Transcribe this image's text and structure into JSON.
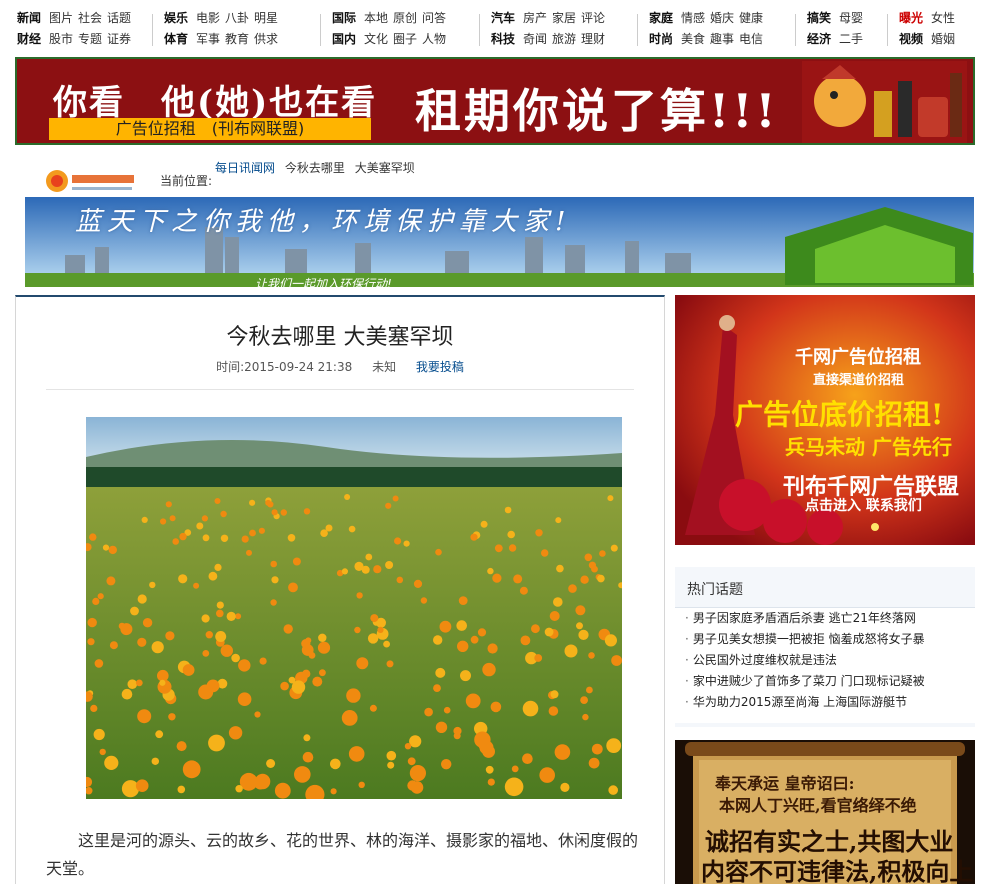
{
  "nav": {
    "groups": [
      {
        "row1": [
          "新闻",
          "图片",
          "社会",
          "话题"
        ],
        "row2": [
          "财经",
          "股市",
          "专题",
          "证券"
        ]
      },
      {
        "row1": [
          "娱乐",
          "电影",
          "八卦",
          "明星"
        ],
        "row2": [
          "体育",
          "军事",
          "教育",
          "供求"
        ]
      },
      {
        "row1": [
          "国际",
          "本地",
          "原创",
          "问答"
        ],
        "row2": [
          "国内",
          "文化",
          "圈子",
          "人物"
        ]
      },
      {
        "row1": [
          "汽车",
          "房产",
          "家居",
          "评论"
        ],
        "row2": [
          "科技",
          "奇闻",
          "旅游",
          "理财"
        ]
      },
      {
        "row1": [
          "家庭",
          "情感",
          "婚庆",
          "健康"
        ],
        "row2": [
          "时尚",
          "美食",
          "趣事",
          "电信"
        ]
      },
      {
        "row1": [
          "搞笑",
          "母婴"
        ],
        "row2": [
          "经济",
          "二手"
        ]
      },
      {
        "row1": [
          "曝光",
          "女性"
        ],
        "row2": [
          "视频",
          "婚姻"
        ]
      }
    ]
  },
  "banner": {
    "left_text": "你看　他(她)也在看",
    "right_text": "租期你说了算!!!",
    "yellow_label": "广告位招租　(刊布网联盟)"
  },
  "breadcrumb": {
    "label": "当前位置:",
    "items": [
      "每日讯闻网",
      "今秋去哪里",
      "大美塞罕坝"
    ]
  },
  "env_banner": {
    "slogan": "蓝天下之你我他，环境保护靠大家!",
    "sub": "让我们一起加入环保行动!"
  },
  "article": {
    "title": "今秋去哪里  大美塞罕坝",
    "time": "时间:2015-09-24 21:38",
    "author": "未知",
    "post_link": "我要投稿",
    "paragraph": "这里是河的源头、云的故乡、花的世界、林的海洋、摄影家的福地、休闲度假的天堂。"
  },
  "side_ad1": {
    "line1": "千网广告位招租",
    "line2": "直接渠道价招租",
    "line3": "广告位底价招租!",
    "line4": "兵马未动 广告先行",
    "line5": "刊布千网广告联盟",
    "line6": "点击进入 联系我们"
  },
  "hot": {
    "title": "热门话题",
    "items": [
      "男子因家庭矛盾酒后杀妻 逃亡21年终落网",
      "男子见美女想摸一把被拒 恼羞成怒将女子暴",
      "公民国外过度维权就是违法",
      "家中进贼少了首饰多了菜刀 门口现标记疑被",
      "华为助力2015源至尚海 上海国际游艇节"
    ],
    "bullet": "·"
  },
  "side_ad2": {
    "line1": "奉天承运 皇帝诏曰:",
    "line2": "本网人丁兴旺,看官络绎不绝",
    "line3": "诚招有实之士,共图大业",
    "line4": "内容不可违律法,积极向上"
  },
  "colors": {
    "banner_red": "#8c1012",
    "link_blue": "#064d8e",
    "article_top": "#234a6e"
  }
}
